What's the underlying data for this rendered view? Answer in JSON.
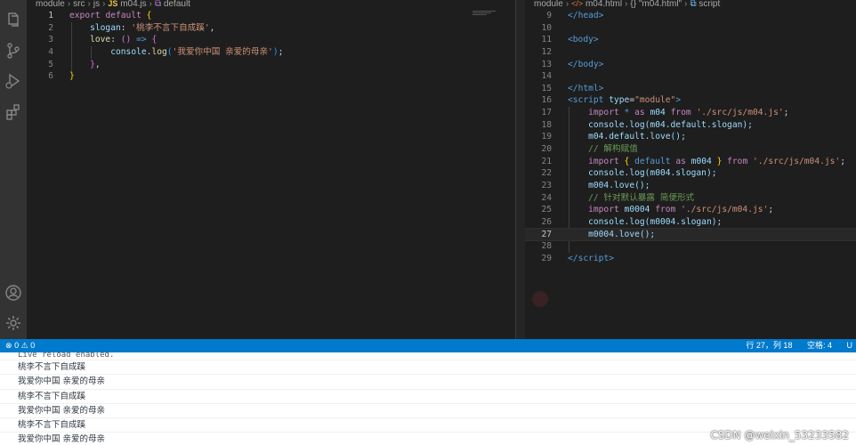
{
  "left_editor": {
    "breadcrumb": [
      "module",
      "src",
      "js",
      "m04.js",
      "default"
    ],
    "file_badge": "JS",
    "lines": [
      {
        "n": "1"
      },
      {
        "n": "2"
      },
      {
        "n": "3"
      },
      {
        "n": "4"
      },
      {
        "n": "5"
      },
      {
        "n": "6"
      }
    ],
    "tokens": {
      "export": "export",
      "default": "default",
      "slogan_key": "slogan",
      "slogan_val": "'桃李不言下自成蹊'",
      "love_key": "love",
      "arrow": "=>",
      "console": "console",
      "log": "log",
      "love_msg": "'我爱你中国 亲爱的母亲'"
    }
  },
  "right_editor": {
    "breadcrumb": [
      "module",
      "m04.html",
      "{} \"m04.html\"",
      "script"
    ],
    "file_badge": "</>",
    "line_numbers": [
      "9",
      "10",
      "11",
      "12",
      "13",
      "14",
      "15",
      "16",
      "17",
      "18",
      "19",
      "20",
      "21",
      "22",
      "23",
      "24",
      "25",
      "26",
      "27",
      "28",
      "29"
    ],
    "active_line": "27",
    "tokens": {
      "head_close": "head",
      "body_open": "body",
      "body_close": "body",
      "html_close": "html",
      "script_tag": "script",
      "type_attr": "type",
      "type_val": "\"module\"",
      "import": "import",
      "star": "*",
      "as": "as",
      "m04": "m04",
      "from": "from",
      "path": "'./src/js/m04.js'",
      "l18": "console.log(m04.default.slogan);",
      "l19": "m04.default.love();",
      "c20": "// 解构赋值",
      "default": "default",
      "m004": "m004",
      "l22": "console.log(m004.slogan);",
      "l23": "m004.love();",
      "c24": "// 针对默认暴露 简便形式",
      "m0004": "m0004",
      "l26": "console.log(m0004.slogan);",
      "l27": "m0004.love();"
    }
  },
  "statusbar": {
    "errors": "0",
    "warnings": "0",
    "position": "行 27，列 18",
    "spaces": "空格: 4",
    "encoding": "U"
  },
  "console": {
    "lines": [
      "Live reload enabled.",
      "桃李不言下自成蹊",
      "我爱你中国 亲爱的母亲",
      "桃李不言下自成蹊",
      "我爱你中国 亲爱的母亲",
      "桃李不言下自成蹊",
      "我爱你中国 亲爱的母亲"
    ]
  },
  "watermark": "CSDN @weixin_53233582",
  "colors": {
    "activity_bar": "#333333",
    "editor_bg": "#1e1e1e",
    "statusbar": "#007acc",
    "keyword": "#c586c0",
    "string": "#ce9178",
    "comment": "#6a9955"
  },
  "icons": [
    "explorer-icon",
    "source-control-icon",
    "run-debug-icon",
    "extensions-icon",
    "account-icon",
    "settings-gear-icon",
    "error-icon",
    "warning-icon"
  ]
}
